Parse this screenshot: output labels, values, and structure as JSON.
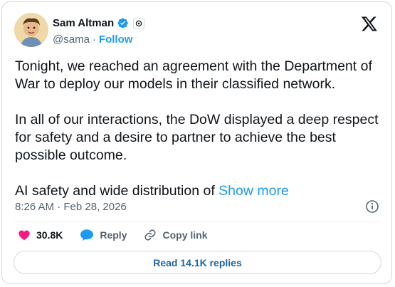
{
  "author": {
    "name": "Sam Altman",
    "handle": "@sama",
    "separator": "·",
    "follow_label": "Follow",
    "verified_icon": "verified-badge-icon",
    "affiliation_icon": "openai-logo-icon"
  },
  "platform_icon": "x-logo-icon",
  "tweet": {
    "paragraphs": [
      "Tonight, we reached an agreement with the Department of War to deploy our models in their classified network.",
      "In all of our interactions, the DoW displayed a deep respect for safety and a desire to partner to achieve the best possible outcome.",
      "AI safety and wide distribution of "
    ],
    "show_more_label": "Show more"
  },
  "meta": {
    "timestamp": "8:26 AM · Feb 28, 2026",
    "info_icon": "info-icon"
  },
  "actions": {
    "likes": "30.8K",
    "reply_label": "Reply",
    "copy_link_label": "Copy link"
  },
  "replies_button_label": "Read 14.1K replies",
  "colors": {
    "accent": "#1d9bf0",
    "like": "#f91880",
    "text": "#0f1419",
    "muted": "#536471"
  }
}
